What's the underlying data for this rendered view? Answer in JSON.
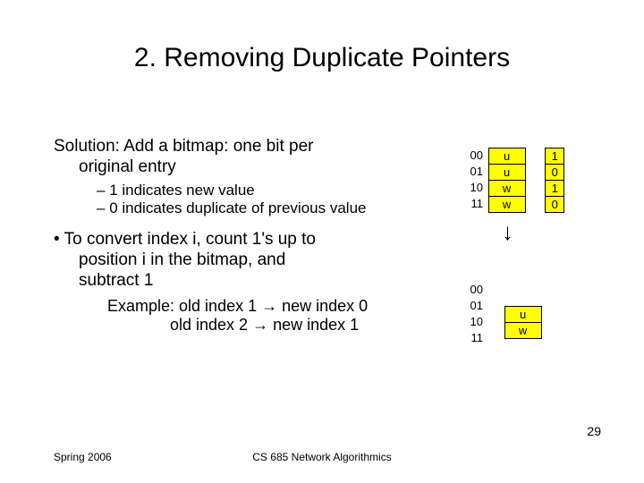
{
  "title": "2. Removing Duplicate Pointers",
  "body": {
    "line1a": "Solution: Add a bitmap: one bit per",
    "line1b": "original entry",
    "sub1": "1 indicates new value",
    "sub2": "0 indicates duplicate of previous value",
    "bullet2a": "To convert index i, count 1's up to",
    "bullet2b": "position i in the bitmap, and",
    "bullet2c": "subtract 1",
    "ex1": "Example: old index 1 → new index 0",
    "ex2": "old index 2 → new index 1"
  },
  "diag1": {
    "labels": [
      "00",
      "01",
      "10",
      "11"
    ],
    "values": [
      "u",
      "u",
      "w",
      "w"
    ],
    "bits": [
      "1",
      "0",
      "1",
      "0"
    ]
  },
  "diag2": {
    "labels": [
      "00",
      "01",
      "10",
      "11"
    ],
    "values": [
      "u",
      "w"
    ]
  },
  "footer": {
    "left": "Spring 2006",
    "center": "CS 685 Network Algorithmics",
    "page": "29"
  }
}
